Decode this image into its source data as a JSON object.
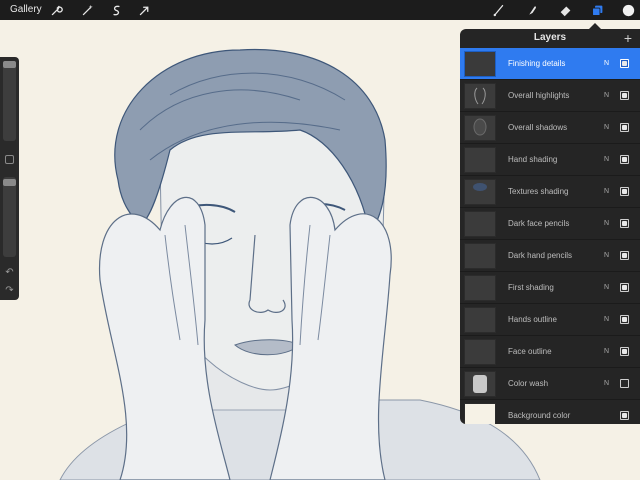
{
  "toolbar": {
    "gallery_label": "Gallery",
    "left_tools": [
      "wrench-icon",
      "magic-wand-icon",
      "selection-icon",
      "transform-icon"
    ],
    "right_tools": [
      "brush-icon",
      "smudge-icon",
      "eraser-icon",
      "layers-icon",
      "color-icon"
    ],
    "accent_color": "#2f7bf0"
  },
  "sidebar": {
    "controls": [
      "brush-size-slider",
      "modify-button",
      "opacity-slider",
      "undo-button",
      "redo-button"
    ]
  },
  "layers_panel": {
    "title": "Layers",
    "add_label": "+",
    "layers": [
      {
        "name": "Finishing details",
        "blend": "N",
        "visible": true,
        "selected": true
      },
      {
        "name": "Overall highlights",
        "blend": "N",
        "visible": true,
        "selected": false
      },
      {
        "name": "Overall shadows",
        "blend": "N",
        "visible": true,
        "selected": false
      },
      {
        "name": "Hand shading",
        "blend": "N",
        "visible": true,
        "selected": false
      },
      {
        "name": "Textures shading",
        "blend": "N",
        "visible": true,
        "selected": false
      },
      {
        "name": "Dark face pencils",
        "blend": "N",
        "visible": true,
        "selected": false
      },
      {
        "name": "Dark hand pencils",
        "blend": "N",
        "visible": true,
        "selected": false
      },
      {
        "name": "First shading",
        "blend": "N",
        "visible": true,
        "selected": false
      },
      {
        "name": "Hands outline",
        "blend": "N",
        "visible": true,
        "selected": false
      },
      {
        "name": "Face outline",
        "blend": "N",
        "visible": true,
        "selected": false
      },
      {
        "name": "Color wash",
        "blend": "N",
        "visible": false,
        "selected": false
      },
      {
        "name": "Background color",
        "blend": "",
        "visible": true,
        "selected": false
      }
    ]
  }
}
